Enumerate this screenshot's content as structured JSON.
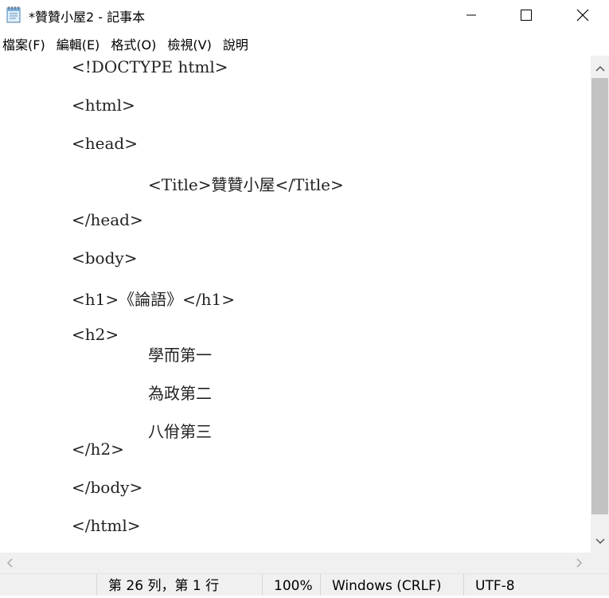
{
  "window": {
    "title": "*贊贊小屋2 - 記事本",
    "icon": "notepad-icon"
  },
  "menu": {
    "items": [
      "檔案(F)",
      "編輯(E)",
      "格式(O)",
      "檢視(V)",
      "說明"
    ]
  },
  "editor": {
    "lines": [
      "<!DOCTYPE html>",
      "<html>",
      "<head>",
      "<Title>贊贊小屋</Title>",
      "</head>",
      "<body>",
      "<h1>《論語》</h1>",
      "<h2>",
      "學而第一",
      "為政第二",
      "八佾第三",
      "</h2>",
      "</body>",
      "</html>"
    ]
  },
  "status": {
    "position": "第 26 列，第 1 行",
    "zoom": "100%",
    "line_ending": "Windows (CRLF)",
    "encoding": "UTF-8"
  }
}
